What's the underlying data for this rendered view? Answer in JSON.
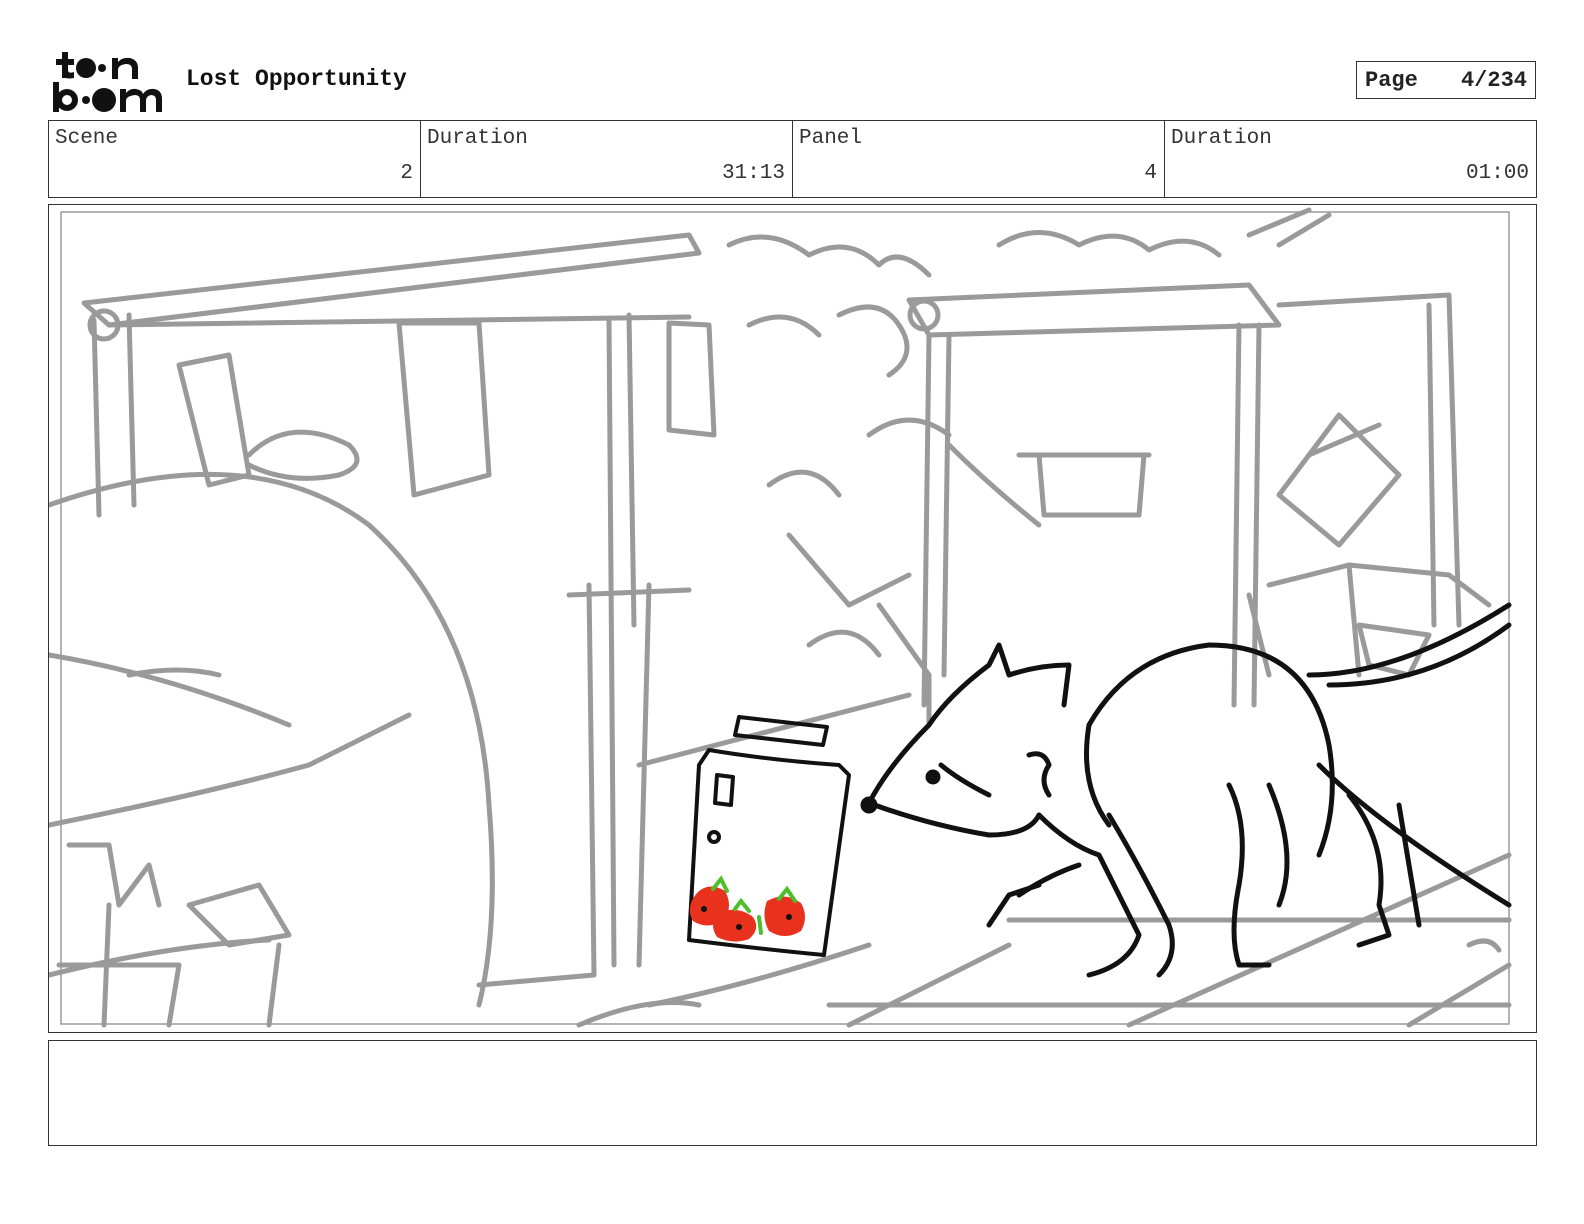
{
  "header": {
    "logo_text": "toon boom",
    "title": "Lost Opportunity",
    "page_label": "Page",
    "page_value": "4/234"
  },
  "info": {
    "scene_label": "Scene",
    "scene_value": "2",
    "scene_duration_label": "Duration",
    "scene_duration_value": "31:13",
    "panel_label": "Panel",
    "panel_value": "4",
    "panel_duration_label": "Duration",
    "panel_duration_value": "01:00"
  },
  "panel_image": {
    "description_icon": "storyboard-sketch",
    "colors": {
      "background_lines": "#9a9a9a",
      "character_lines": "#111111",
      "strawberries": "#e8321e",
      "leaves": "#4cc02a"
    }
  },
  "notes": {
    "text": ""
  }
}
